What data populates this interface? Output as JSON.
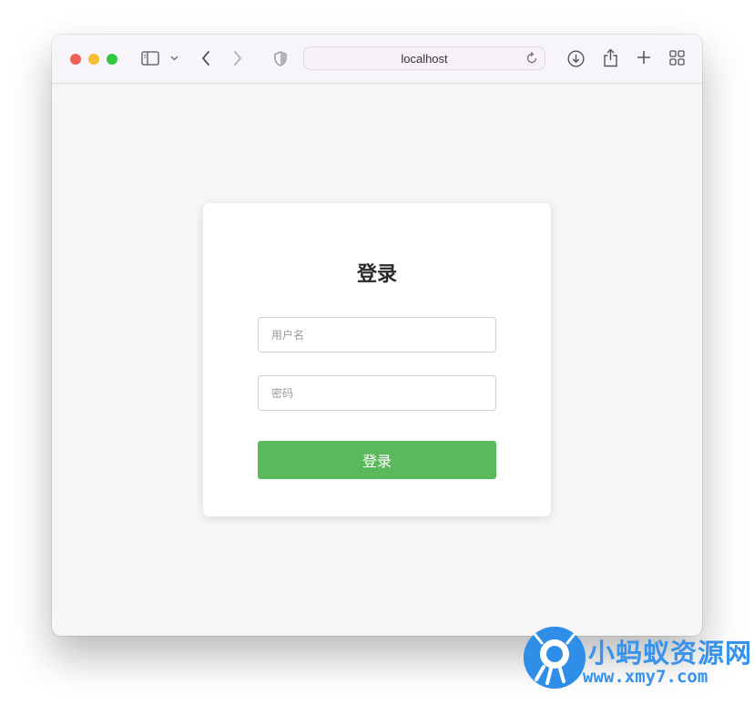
{
  "browser": {
    "address": "localhost",
    "icons": [
      "sidebar-icon",
      "chevron-down-icon",
      "back-icon",
      "forward-icon",
      "privacy-shield-icon",
      "reload-icon",
      "download-icon",
      "share-icon",
      "new-tab-icon",
      "tab-overview-icon"
    ]
  },
  "login": {
    "title": "登录",
    "username_placeholder": "用户名",
    "password_placeholder": "密码",
    "submit_label": "登录"
  },
  "watermark": {
    "name": "小蚂蚁资源网",
    "url": "www.xmy7.com"
  },
  "colors": {
    "accent_button": "#5cb85c",
    "watermark_blue": "#3a93ea",
    "page_background": "#f6f6f7"
  }
}
